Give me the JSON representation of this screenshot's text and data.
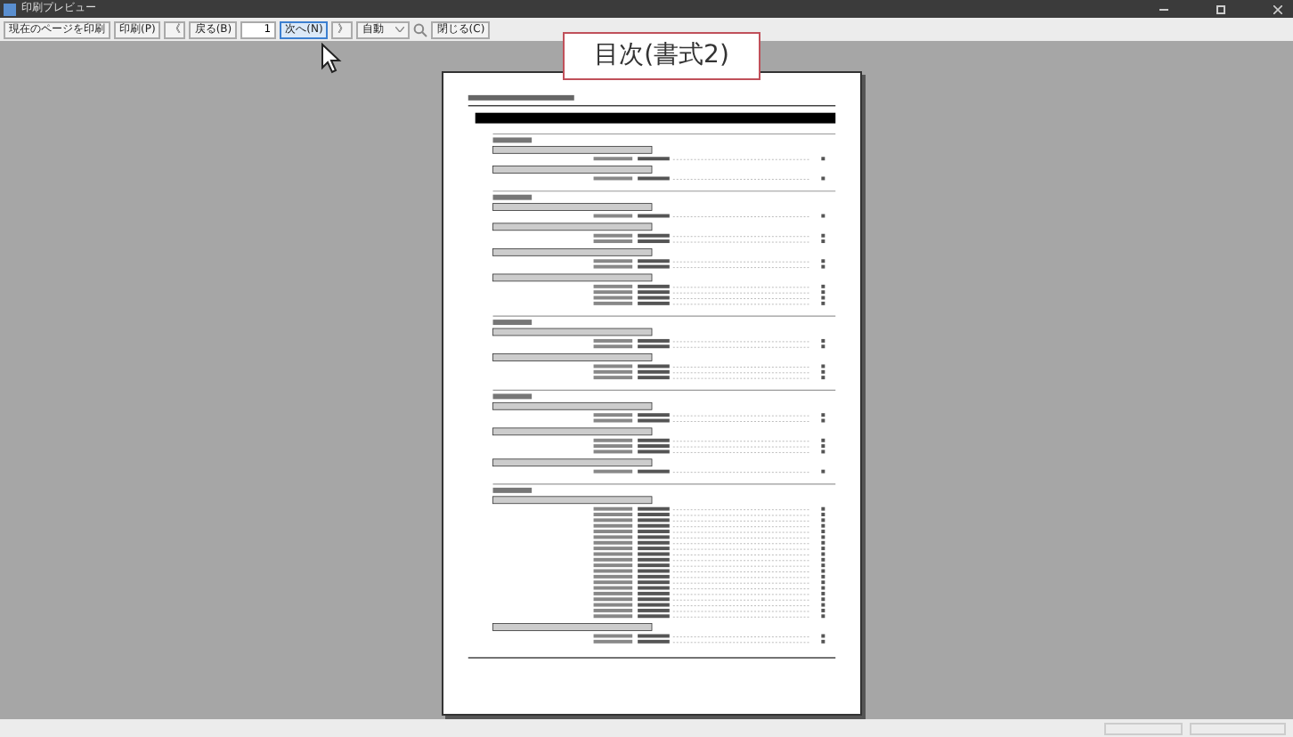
{
  "window": {
    "title": "印刷プレビュー"
  },
  "toolbar": {
    "print_current": "現在のページを印刷",
    "print": "印刷(P)",
    "first": "《",
    "back": "戻る(B)",
    "page": "1",
    "next": "次へ(N)",
    "last": "》",
    "zoom": "自動",
    "close": "閉じる(C)"
  },
  "callout": "目次(書式2)"
}
